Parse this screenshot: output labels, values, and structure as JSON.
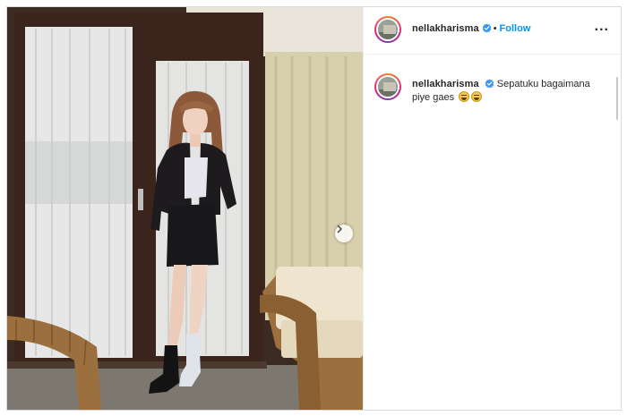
{
  "post": {
    "username": "nellakharisma",
    "follow_label": "Follow",
    "separator": "•",
    "more_label": "...",
    "caption_text": "Sepatuku bagaimana piye gaes",
    "caption_emojis": [
      "grinning-sweat-emoji",
      "grinning-sweat-emoji"
    ]
  },
  "media": {
    "next_icon": "chevron-right-icon"
  },
  "colors": {
    "follow": "#0095f6",
    "verified": "#3897f0",
    "text": "#262626",
    "border": "#dbdbdb"
  }
}
